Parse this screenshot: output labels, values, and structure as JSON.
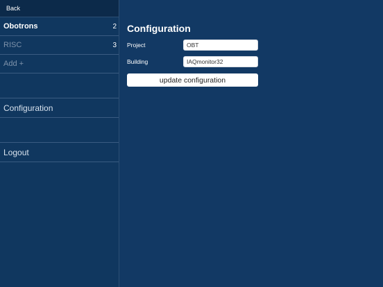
{
  "sidebar": {
    "back_label": "Back",
    "projects": [
      {
        "label": "Obotrons",
        "count": "2"
      },
      {
        "label": "RISC",
        "count": "3"
      }
    ],
    "add_label": "Add +",
    "configuration_label": "Configuration",
    "logout_label": "Logout"
  },
  "main": {
    "title": "Configuration",
    "project_label": "Project",
    "project_value": "OBT",
    "building_label": "Building",
    "building_value": "IAQmonitor32",
    "update_button_label": "update configuration"
  },
  "colors": {
    "background": "#103660",
    "sidebar_header": "#0c2a4a",
    "dim_text": "#7f93ab",
    "divider": "#3a5c82"
  }
}
